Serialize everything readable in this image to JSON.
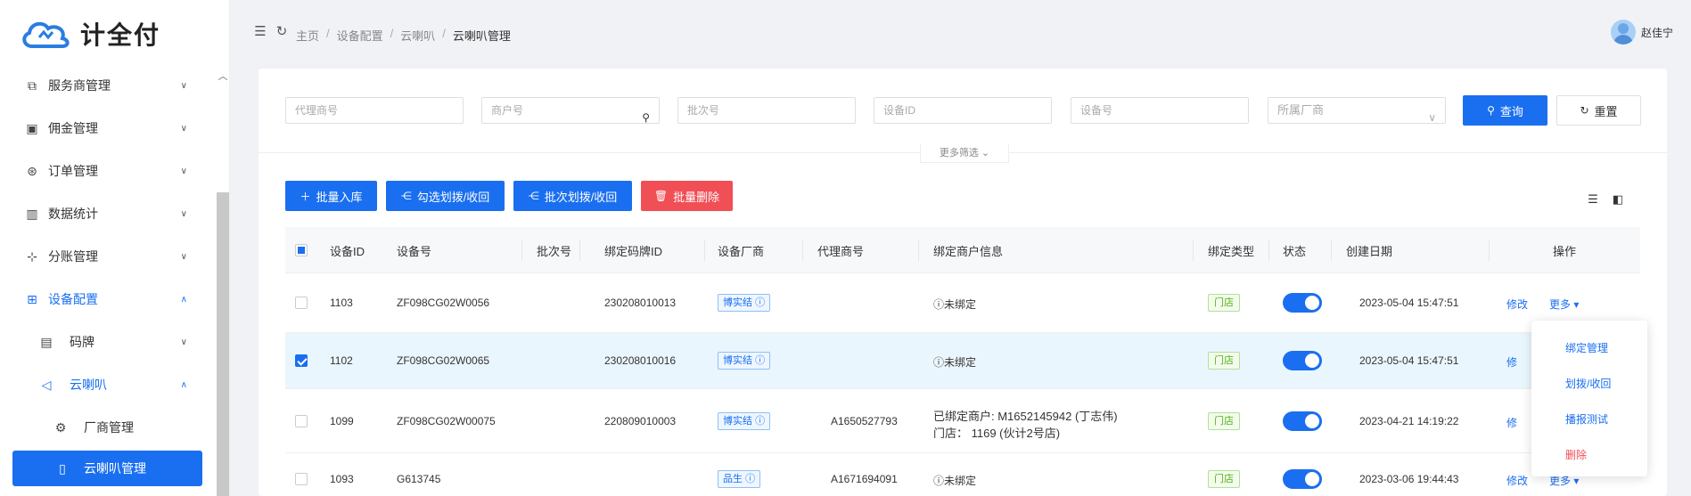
{
  "app": {
    "logo_text": "计全付"
  },
  "sidebar": {
    "items": [
      {
        "label": "服务商管理",
        "icon": "store-icon"
      },
      {
        "label": "佣金管理",
        "icon": "wallet-icon"
      },
      {
        "label": "订单管理",
        "icon": "order-icon"
      },
      {
        "label": "数据统计",
        "icon": "bar-chart-icon"
      },
      {
        "label": "分账管理",
        "icon": "split-icon"
      },
      {
        "label": "设备配置",
        "icon": "grid-icon"
      },
      {
        "label": "码牌",
        "icon": "qrcode-board-icon"
      },
      {
        "label": "云喇叭",
        "icon": "speaker-icon"
      },
      {
        "label": "厂商管理",
        "icon": "gear-icon"
      },
      {
        "label": "云喇叭管理",
        "icon": "document-icon"
      }
    ]
  },
  "breadcrumb": [
    "主页",
    "设备配置",
    "云喇叭",
    "云喇叭管理"
  ],
  "user": {
    "name": "赵佳宁"
  },
  "filters": {
    "agent_no": "代理商号",
    "merchant_no": "商户号",
    "batch_no": "批次号",
    "device_id": "设备ID",
    "device_no": "设备号",
    "vendor": "所属厂商",
    "search_label": "查询",
    "reset_label": "重置",
    "more_filter": "更多筛选"
  },
  "actions": {
    "batch_import": "批量入库",
    "select_assign": "勾选划拨/收回",
    "batch_assign": "批次划拨/收回",
    "batch_delete": "批量删除"
  },
  "table": {
    "headers": [
      "设备ID",
      "设备号",
      "批次号",
      "绑定码牌ID",
      "设备厂商",
      "代理商号",
      "绑定商户信息",
      "绑定类型",
      "状态",
      "创建日期",
      "操作"
    ],
    "rows": [
      {
        "id": "1103",
        "device_no": "ZF098CG02W0056",
        "batch": "",
        "qr_id": "230208010013",
        "vendor": "博实结",
        "agent": "",
        "merchant_line1": "未绑定",
        "merchant_line2": "",
        "bind_type": "门店",
        "created": "2023-05-04 15:47:51",
        "edit": "修改",
        "more": "更多",
        "checked": false
      },
      {
        "id": "1102",
        "device_no": "ZF098CG02W0065",
        "batch": "",
        "qr_id": "230208010016",
        "vendor": "博实结",
        "agent": "",
        "merchant_line1": "未绑定",
        "merchant_line2": "",
        "bind_type": "门店",
        "created": "2023-05-04 15:47:51",
        "edit": "修",
        "more": "",
        "checked": true
      },
      {
        "id": "1099",
        "device_no": "ZF098CG02W00075",
        "batch": "",
        "qr_id": "220809010003",
        "vendor": "博实结",
        "agent": "A1650527793",
        "merchant_line1": "已绑定商户: M1652145942 (丁志伟)",
        "merchant_line2": "门店：  1169 (伙计2号店)",
        "bind_type": "门店",
        "created": "2023-04-21 14:19:22",
        "edit": "修",
        "more": "",
        "checked": false
      },
      {
        "id": "1093",
        "device_no": "G613745",
        "batch": "",
        "qr_id": "",
        "vendor": "品生",
        "agent": "A1671694091",
        "merchant_line1": "未绑定",
        "merchant_line2": "",
        "bind_type": "门店",
        "created": "2023-03-06 19:44:43",
        "edit": "修改",
        "more": "更多",
        "checked": false
      }
    ]
  },
  "dropdown": {
    "items": [
      "绑定管理",
      "划拨/收回",
      "播报测试",
      "删除"
    ]
  },
  "colors": {
    "primary": "#1a6ff0",
    "danger": "#f04f56",
    "success": "#52b01a"
  }
}
